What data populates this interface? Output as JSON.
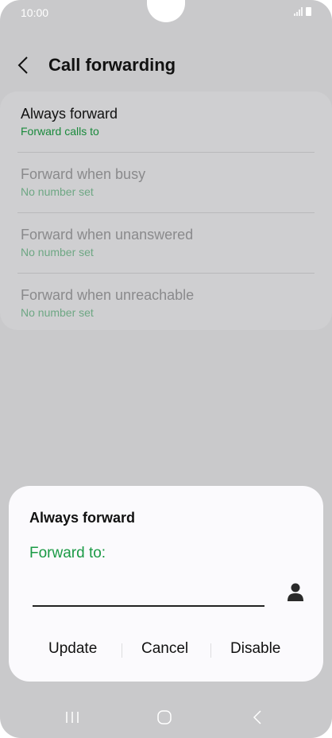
{
  "status_bar": {
    "time": "10:00"
  },
  "header": {
    "title": "Call forwarding"
  },
  "settings": {
    "items": [
      {
        "title": "Always forward",
        "subtitle": "Forward calls to"
      },
      {
        "title": "Forward when busy",
        "subtitle": "No number set"
      },
      {
        "title": "Forward when unanswered",
        "subtitle": "No number set"
      },
      {
        "title": "Forward when unreachable",
        "subtitle": "No number set"
      }
    ]
  },
  "dialog": {
    "title": "Always forward",
    "label": "Forward to:",
    "input_value": "",
    "buttons": {
      "update": "Update",
      "cancel": "Cancel",
      "disable": "Disable"
    }
  },
  "colors": {
    "accent": "#1a9a45",
    "scrim": "#c9c9cb",
    "sheet": "#fbfafd"
  },
  "icons": [
    "back-arrow-icon",
    "contact-person-icon",
    "recent-apps-icon",
    "home-icon",
    "back-nav-icon",
    "signal-icon",
    "battery-icon"
  ]
}
